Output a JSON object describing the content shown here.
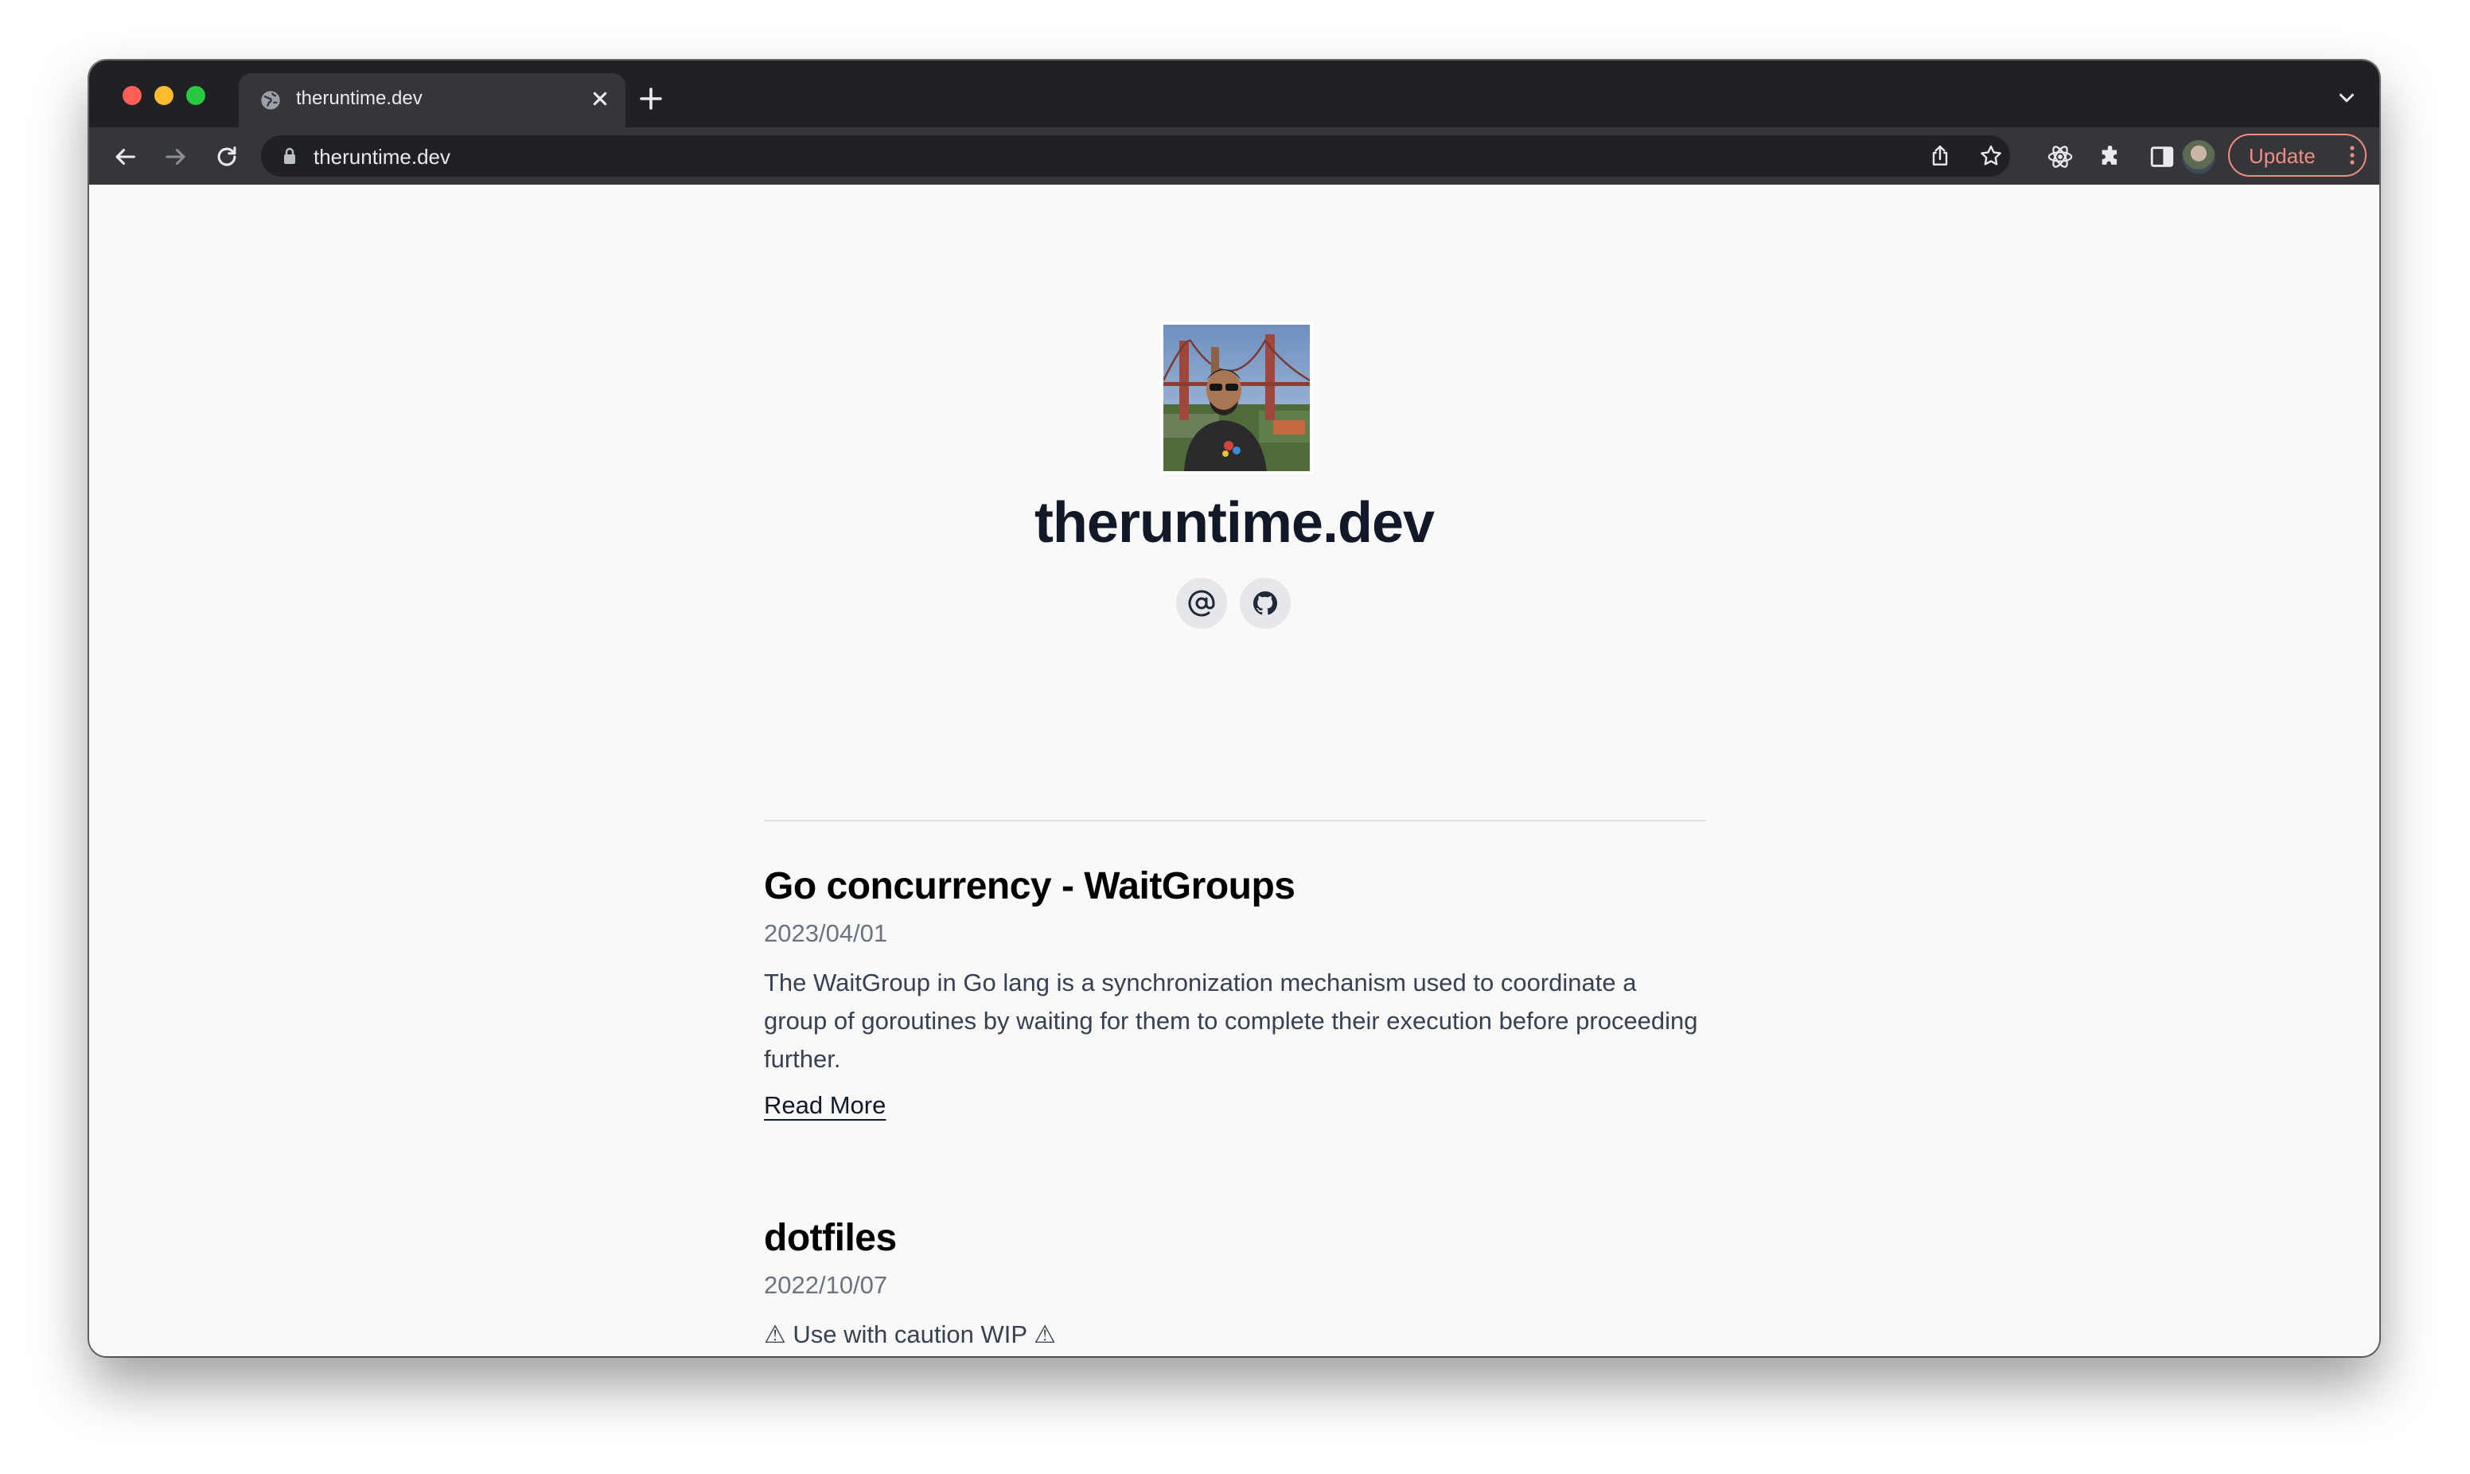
{
  "browser": {
    "tab": {
      "title": "theruntime.dev"
    },
    "address_bar": {
      "url": "theruntime.dev"
    },
    "update_button": {
      "label": "Update"
    },
    "icons": [
      "globe-icon",
      "close-icon",
      "plus-icon",
      "chevron-down-icon",
      "back-arrow-icon",
      "forward-arrow-icon",
      "reload-icon",
      "lock-icon",
      "share-icon",
      "star-icon",
      "react-devtools-icon",
      "puzzle-icon",
      "side-panel-icon",
      "more-vert-icon"
    ],
    "colors": {
      "frame": "#202124",
      "toolbar": "#35363a",
      "update_accent": "#f28b82"
    }
  },
  "page": {
    "site_title": "theruntime.dev",
    "social_icons": [
      "at-sign-icon",
      "github-icon"
    ],
    "posts": [
      {
        "title": "Go concurrency - WaitGroups",
        "date": "2023/04/01",
        "excerpt": "The WaitGroup in Go lang is a synchronization mechanism used to coordinate a group of goroutines by waiting for them to complete their execution before proceeding further.",
        "link_label": "Read More"
      },
      {
        "title": "dotfiles",
        "date": "2022/10/07",
        "excerpt": "⚠ Use with caution WIP ⚠"
      }
    ]
  }
}
